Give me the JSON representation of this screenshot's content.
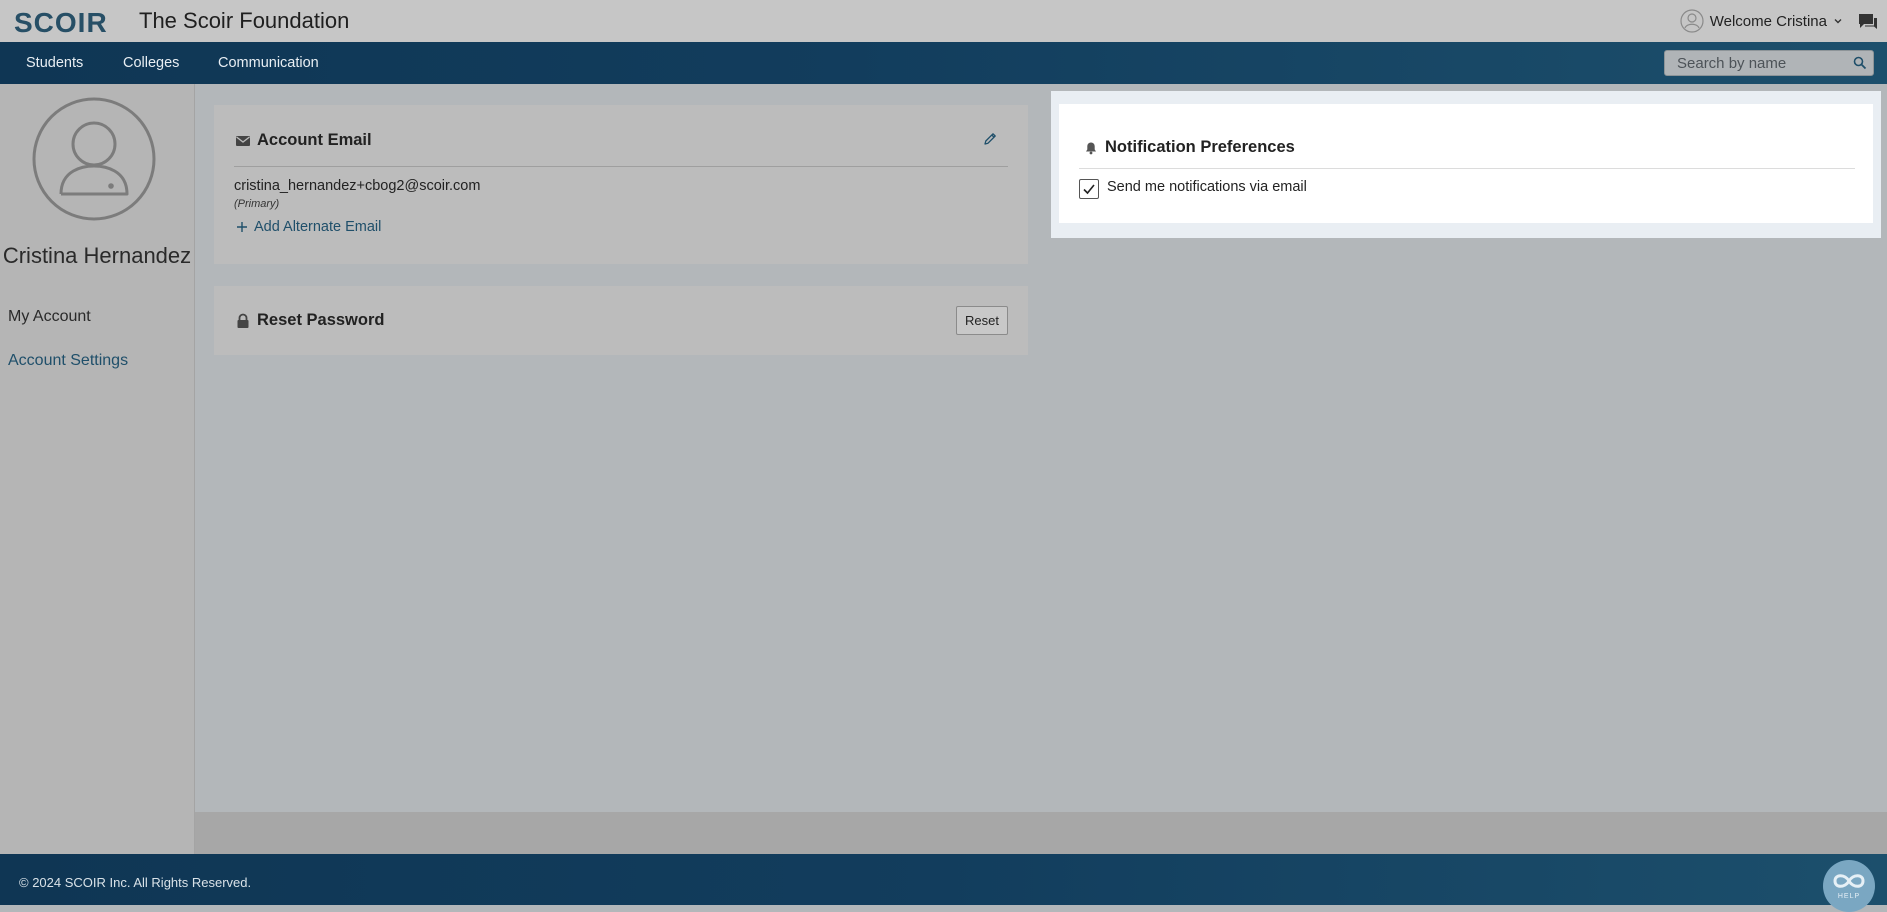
{
  "header": {
    "logo_text": "SCOIR",
    "org_title": "The Scoir Foundation",
    "welcome": "Welcome Cristina",
    "icons": [
      "user-circle-icon",
      "chevron-down-icon",
      "chat-icon"
    ]
  },
  "nav": {
    "items": [
      {
        "label": "Students"
      },
      {
        "label": "Colleges"
      },
      {
        "label": "Communication"
      }
    ],
    "search_placeholder": "Search by name"
  },
  "sidebar": {
    "user_name": "Cristina Hernandez",
    "links": [
      {
        "label": "My Account"
      },
      {
        "label": "Account Settings"
      }
    ]
  },
  "account_email": {
    "title": "Account Email",
    "email": "cristina_hernandez+cbog2@scoir.com",
    "primary_tag": "(Primary)",
    "add_alternate": "Add Alternate Email"
  },
  "reset_password": {
    "title": "Reset Password",
    "button": "Reset"
  },
  "notifications": {
    "title": "Notification Preferences",
    "email_option": "Send me notifications via email",
    "email_checked": true
  },
  "footer": {
    "copyright": "© 2024 SCOIR Inc. All Rights Reserved.",
    "help_label": "HELP"
  },
  "colors": {
    "nav_blue": "#123d5d",
    "link_blue": "#1f4f6a",
    "brand": "#274f66"
  }
}
